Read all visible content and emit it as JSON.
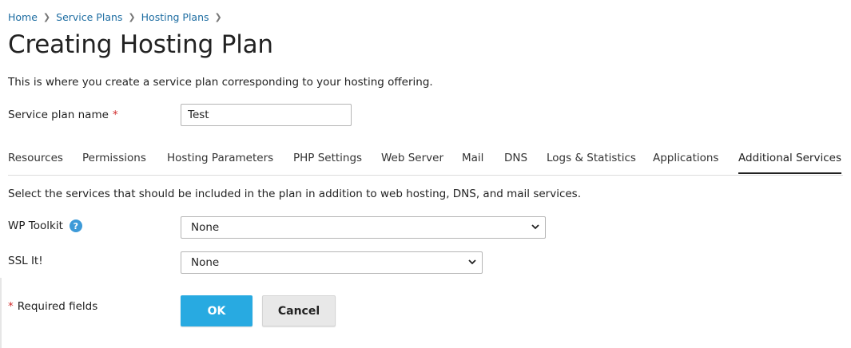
{
  "breadcrumb": [
    {
      "label": "Home"
    },
    {
      "label": "Service Plans"
    },
    {
      "label": "Hosting Plans"
    }
  ],
  "page": {
    "title": "Creating Hosting Plan",
    "intro": "This is where you create a service plan corresponding to your hosting offering."
  },
  "form": {
    "plan_name_label": "Service plan name",
    "required_mark": "*",
    "plan_name_value": "Test"
  },
  "tabs": [
    {
      "label": "Resources"
    },
    {
      "label": "Permissions"
    },
    {
      "label": "Hosting Parameters"
    },
    {
      "label": "PHP Settings"
    },
    {
      "label": "Web Server"
    },
    {
      "label": "Mail"
    },
    {
      "label": "DNS"
    },
    {
      "label": "Logs & Statistics"
    },
    {
      "label": "Applications"
    },
    {
      "label": "Additional Services",
      "active": true
    }
  ],
  "services": {
    "description": "Select the services that should be included in the plan in addition to web hosting, DNS, and mail services.",
    "wp_toolkit_label": "WP Toolkit",
    "wp_toolkit_value": "None",
    "ssl_label": "SSL It!",
    "ssl_value": "None",
    "help_glyph": "?"
  },
  "footer": {
    "required_star": "*",
    "required_note": "Required fields",
    "ok_label": "OK",
    "cancel_label": "Cancel"
  },
  "icons": {
    "breadcrumb_separator": "chevron-right-icon",
    "help": "help-icon",
    "select": "chevron-down-icon"
  },
  "colors": {
    "link": "#1c6ca1",
    "required": "#d02c2c",
    "primary_button": "#28aae1",
    "help_icon": "#3d9ad8"
  }
}
